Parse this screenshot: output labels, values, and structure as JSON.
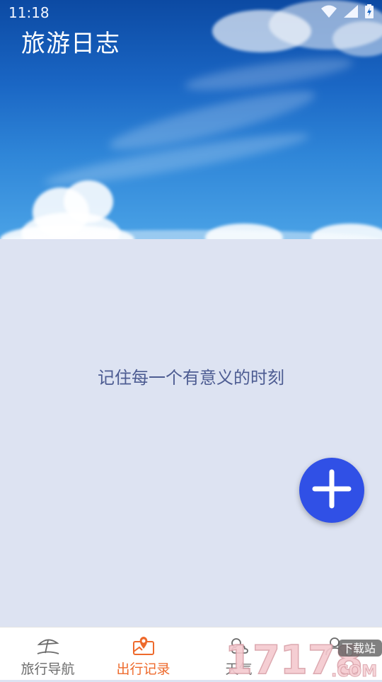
{
  "status_bar": {
    "time": "11:18"
  },
  "header": {
    "title": "旅游日志"
  },
  "main": {
    "empty_message": "记住每一个有意义的时刻"
  },
  "fab": {
    "icon": "plus-icon",
    "color": "#3050e6"
  },
  "bottom_nav": {
    "items": [
      {
        "label": "旅行导航",
        "icon": "beach-umbrella-icon",
        "active": false
      },
      {
        "label": "出行记录",
        "icon": "map-pin-icon",
        "active": true
      },
      {
        "label": "天气",
        "icon": "weather-icon",
        "active": false
      },
      {
        "label": "",
        "icon": "profile-icon",
        "active": false
      }
    ],
    "active_color": "#ee6a2c",
    "inactive_color": "#6b6b6b"
  },
  "watermark": {
    "text": "17178",
    "domain": ".COM",
    "tag": "下载站"
  }
}
